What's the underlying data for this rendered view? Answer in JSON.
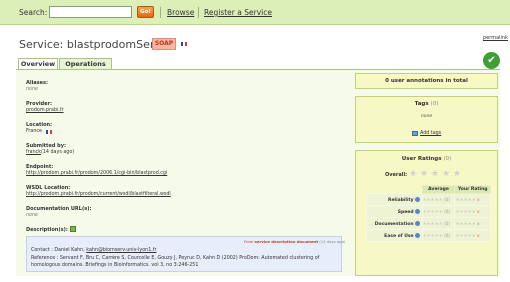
{
  "header": {
    "search_label": "Search:",
    "search_value": "",
    "go_label": "Go!",
    "browse_label": "Browse",
    "register_label": "Register a Service"
  },
  "permalink": "permalink",
  "service": {
    "title": "Service: blastprodomService",
    "type_badge": "SOAP"
  },
  "tabs": [
    {
      "label": "Overview"
    },
    {
      "label": "Operations (1)"
    }
  ],
  "fields": {
    "aliases_label": "Aliases:",
    "aliases_value": "none",
    "provider_label": "Provider:",
    "provider_value": "prodom.prabi.fr",
    "location_label": "Location:",
    "location_value": "France",
    "submitted_label": "Submitted by:",
    "submitted_user": "franck",
    "submitted_when": "(14 days ago)",
    "endpoint_label": "Endpoint:",
    "endpoint_value": "http://prodom.prabi.fr/prodom/2006.1/cgi-bin/blastprod.cgi",
    "wsdl_label": "WSDL Location:",
    "wsdl_value": "http://prodom.prabi.fr/prodom/current/wsdl/blastfilteral.wsdl",
    "docurl_label": "Documentation URL(s):",
    "docurl_value": "none",
    "desc_label": "Description(s):"
  },
  "description": {
    "source_prefix": "From",
    "source_link": "service description document",
    "source_when": "(14 days ago)",
    "contact_prefix": "Contact : Daniel Kahn,",
    "contact_email": "kahn@biomserv.univ-lyon1.fr",
    "reference_line1": "Reference : Servant F, Bru C, Carrère S, Courcelle E, Gouzy J, Peyruc D, Kahn D (2002) ProDom: Automated clustering of",
    "reference_line2": "homologous domains. Briefings in Bioinformatics. vol 3, no 3:246-251"
  },
  "sidebar": {
    "annotations": "0 user annotations in total",
    "tags_title": "Tags",
    "tags_count": "(0)",
    "tags_value": "none",
    "add_tags": "Add tags",
    "ratings_title": "User Ratings",
    "ratings_count": "(0)",
    "overall_label": "Overall:",
    "col_average": "Average",
    "col_your": "Your Rating",
    "rows": [
      {
        "label": "Reliability",
        "avg_count": "(0)"
      },
      {
        "label": "Speed",
        "avg_count": "(0)"
      },
      {
        "label": "Documentation",
        "avg_count": "(0)"
      },
      {
        "label": "Ease of Use",
        "avg_count": "(0)"
      }
    ],
    "mini_stars": "★★★★★",
    "x_mark": "x"
  },
  "icons": {
    "check": "✔",
    "star": "★"
  },
  "colors": {
    "topbar_bg": "#dcefb9",
    "panel_bg": "#f6fbe9",
    "side_box_bg": "#f6f8c5",
    "soap_badge_bg": "#f5b7a4",
    "go_button": "#df6a12",
    "check_green": "#3ea034"
  }
}
